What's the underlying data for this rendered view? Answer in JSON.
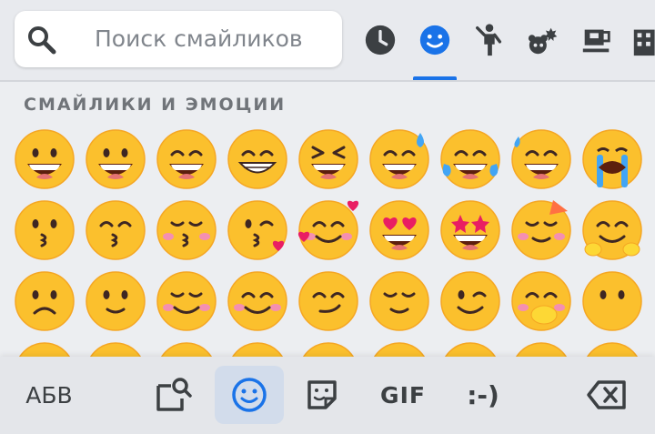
{
  "search": {
    "placeholder": "Поиск смайликов",
    "icon": "search-icon"
  },
  "categories": [
    {
      "name": "recent",
      "icon": "clock-icon",
      "active": false
    },
    {
      "name": "smileys",
      "icon": "smiley-icon",
      "active": true
    },
    {
      "name": "people",
      "icon": "person-icon",
      "active": false
    },
    {
      "name": "animals",
      "icon": "bear-icon",
      "active": false
    },
    {
      "name": "food",
      "icon": "cup-icon",
      "active": false
    },
    {
      "name": "travel",
      "icon": "building-icon",
      "active": false
    }
  ],
  "section": {
    "title": "СМАЙЛИКИ И ЭМОЦИИ"
  },
  "emojis": [
    [
      "grinning",
      "grinning-big-eyes",
      "grinning-smiling-eyes",
      "beaming",
      "squinting",
      "sweat-smile",
      "joy",
      "rofl",
      "loudly-crying"
    ],
    [
      "kissing",
      "kissing-smiling-eyes",
      "kissing-closed-eyes",
      "face-blowing-kiss",
      "smiling-hearts",
      "heart-eyes",
      "star-struck",
      "partying",
      "hugging"
    ],
    [
      "upside-down",
      "slightly-smiling",
      "smiling-blush",
      "relieved-smile",
      "smirk",
      "relieved",
      "winking",
      "hand-over-mouth",
      "neutral-dots"
    ]
  ],
  "bottom": {
    "abc_label": "АБВ",
    "gif_label": "GIF",
    "emoticon_label": ":-)",
    "icons": [
      "sticker-search-icon",
      "emoji-icon",
      "sticker-icon",
      "backspace-icon"
    ]
  },
  "colors": {
    "accent": "#1a73e8",
    "emoji_yellow": "#fbc02d",
    "active_bg": "#d2dceb"
  }
}
